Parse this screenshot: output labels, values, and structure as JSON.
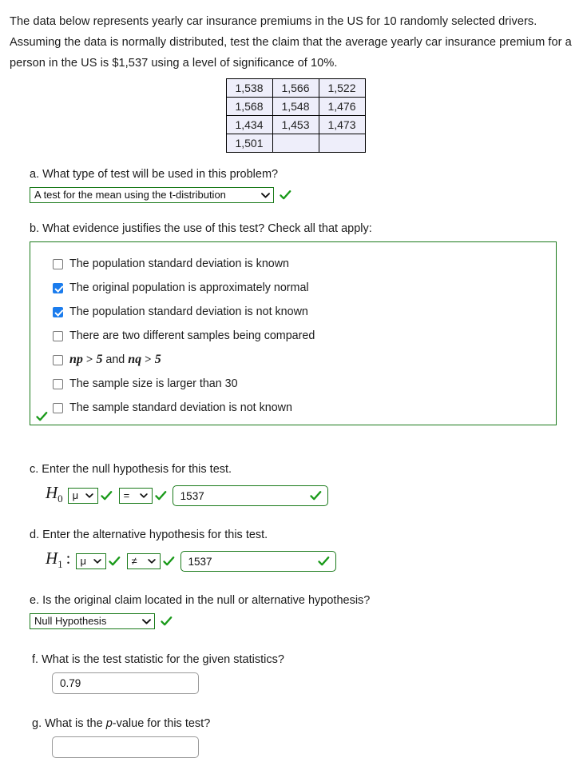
{
  "intro": "The data below represents yearly car insurance premiums in the US for 10 randomly selected drivers. Assuming the data is normally distributed, test the claim that the average yearly car insurance premium for a person in the US is $1,537 using a level of significance of 10%.",
  "data_table": {
    "rows": [
      [
        "1,538",
        "1,566",
        "1,522"
      ],
      [
        "1,568",
        "1,548",
        "1,476"
      ],
      [
        "1,434",
        "1,453",
        "1,473"
      ],
      [
        "1,501",
        "",
        ""
      ]
    ]
  },
  "colors": {
    "valid_green": "#1a7a1a",
    "checkbox_blue": "#1b7ced",
    "table_bg": "#eeeefa",
    "input_border_grey": "#999999"
  },
  "part_a": {
    "label": "a. What type of test will be used in this problem?",
    "select_value": "A test for the mean using the t-distribution"
  },
  "part_b": {
    "label": "b. What evidence justifies the use of this test? Check all that apply:",
    "options": [
      {
        "text": "The population standard deviation is known",
        "checked": false
      },
      {
        "text": "The original population is approximately normal",
        "checked": true
      },
      {
        "text": "The population standard deviation is not known",
        "checked": true
      },
      {
        "text": "There are two different samples being compared",
        "checked": false
      },
      {
        "text": "np > 5 and nq > 5",
        "checked": false
      },
      {
        "text": "The sample size is larger than 30",
        "checked": false
      },
      {
        "text": "The sample standard deviation is not known",
        "checked": false
      }
    ]
  },
  "part_c": {
    "label": "c. Enter the null hypothesis for this test.",
    "symbol": "H",
    "subscript": "0",
    "param_select": "μ",
    "operator_select": "=",
    "value": "1537"
  },
  "part_d": {
    "label": "d. Enter the alternative hypothesis for this test.",
    "symbol": "H",
    "subscript": "1",
    "colon": ":",
    "param_select": "μ",
    "operator_select": "≠",
    "value": "1537"
  },
  "part_e": {
    "label": "e. Is the original claim located in the null or alternative hypothesis?",
    "select_value": "Null Hypothesis"
  },
  "part_f": {
    "label_before": "f. What is the test statistic for the given statistics?",
    "value": "0.79"
  },
  "part_g": {
    "label_pre": "g. What is the ",
    "label_ital": "p",
    "label_post": "-value for this test?",
    "value": ""
  }
}
